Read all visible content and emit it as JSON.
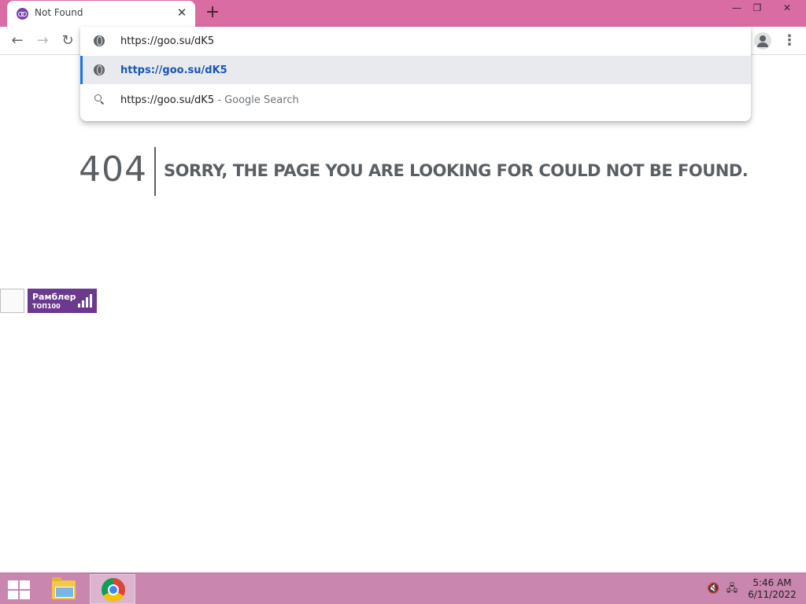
{
  "browser": {
    "tab_title": "Not Found",
    "tab_close": "✕",
    "new_tab": "+",
    "window_controls": {
      "minimize": "—",
      "restore": "❐",
      "close": "✕"
    }
  },
  "toolbar": {
    "back": "←",
    "forward": "→",
    "reload": "↻",
    "menu": "⋮"
  },
  "omnibox": {
    "input_value": "https://goo.su/dK5",
    "suggestions": [
      {
        "icon": "globe-icon",
        "text": "https://goo.su/dK5",
        "desc": ""
      },
      {
        "icon": "search-icon",
        "text": "https://goo.su/dK5",
        "desc": " - Google Search"
      }
    ]
  },
  "page": {
    "error_code": "404",
    "error_message": "SORRY, THE PAGE YOU ARE LOOKING FOR COULD NOT BE FOUND.",
    "rambler_badge": {
      "name": "Рамблер",
      "sub": "ТОП100"
    }
  },
  "taskbar": {
    "clock_time": "5:46 AM",
    "clock_date": "6/11/2022",
    "volume_icon": "🔇",
    "network_icon": "🖧"
  },
  "colors": {
    "titlebar": "#d96ca3",
    "taskbar": "#c986ae",
    "accent": "#1a73e8",
    "error_text": "#5a5f63",
    "rambler_bg": "#6b3a8f"
  }
}
